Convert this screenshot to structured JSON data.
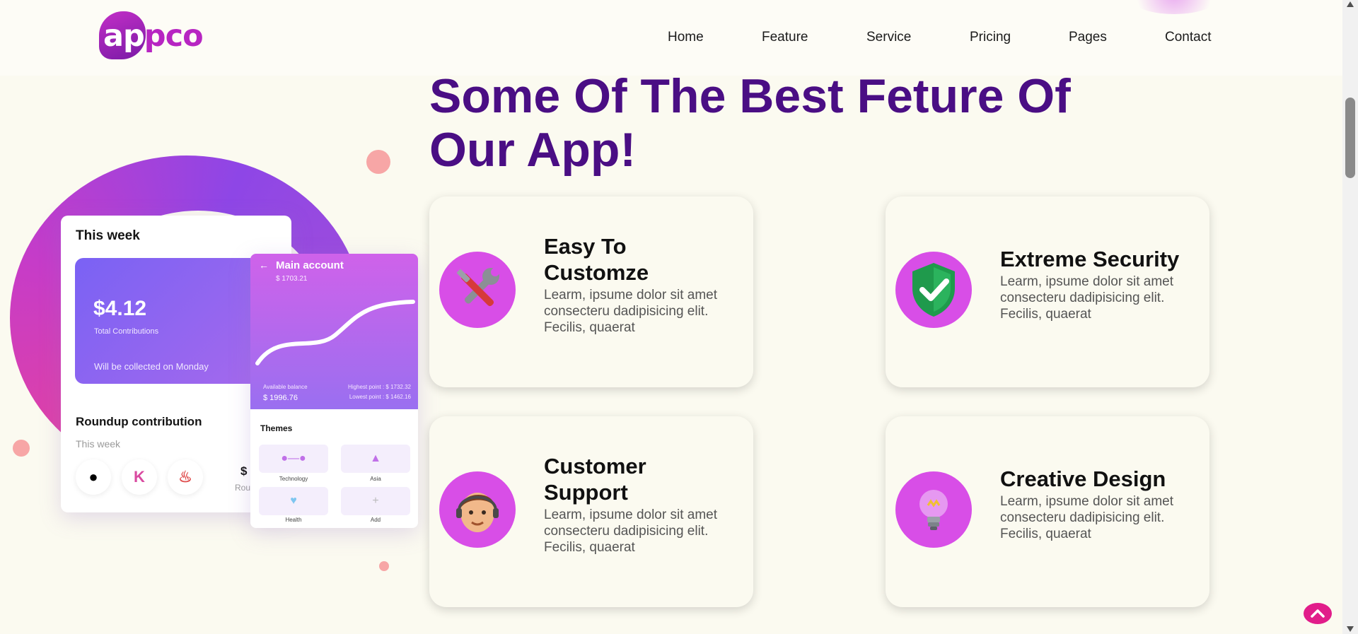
{
  "brand": {
    "logo_part1": "ap",
    "logo_part2": "pco"
  },
  "nav": {
    "items": [
      "Home",
      "Feature",
      "Service",
      "Pricing",
      "Pages",
      "Contact"
    ]
  },
  "section": {
    "heading": "Some Of The Best Feture Of Our App!"
  },
  "mockup": {
    "week_title": "This week",
    "amount": "$4.12",
    "total_label": "Total Contributions",
    "collect_note": "Will be collected on Monday",
    "roundup_title": "Roundup contribution",
    "roundup_period": "This week",
    "roundup_value": "$",
    "roundup_label": "Rou",
    "account_title": "Main account",
    "account_value": "$ 1703.21",
    "available_label": "Available balance",
    "available_value": "$ 1996.76",
    "highest_point": "Highest point : $ 1732.32",
    "lowest_point": "Lowest point : $ 1462.16",
    "themes_title": "Themes",
    "themes": [
      "Technology",
      "Asia",
      "Health",
      "Add"
    ]
  },
  "features": [
    {
      "title": "Easy To Customze",
      "desc": "Learm, ipsume dolor sit amet consecteru dadipisicing elit. Fecilis, quaerat",
      "icon": "tools-icon"
    },
    {
      "title": "Extreme Security",
      "desc": "Learm, ipsume dolor sit amet consecteru dadipisicing elit. Fecilis, quaerat",
      "icon": "shield-check-icon"
    },
    {
      "title": "Customer Support",
      "desc": "Learm, ipsume dolor sit amet consecteru dadipisicing elit. Fecilis, quaerat",
      "icon": "support-agent-icon"
    },
    {
      "title": "Creative Design",
      "desc": "Learm, ipsume dolor sit amet consecteru dadipisicing elit. Fecilis, quaerat",
      "icon": "lightbulb-icon"
    }
  ],
  "colors": {
    "heading": "#4a0e84",
    "icon_bg": "#d84ee7",
    "back_to_top": "#e11d8a",
    "page_bg": "#fbfaf0"
  }
}
